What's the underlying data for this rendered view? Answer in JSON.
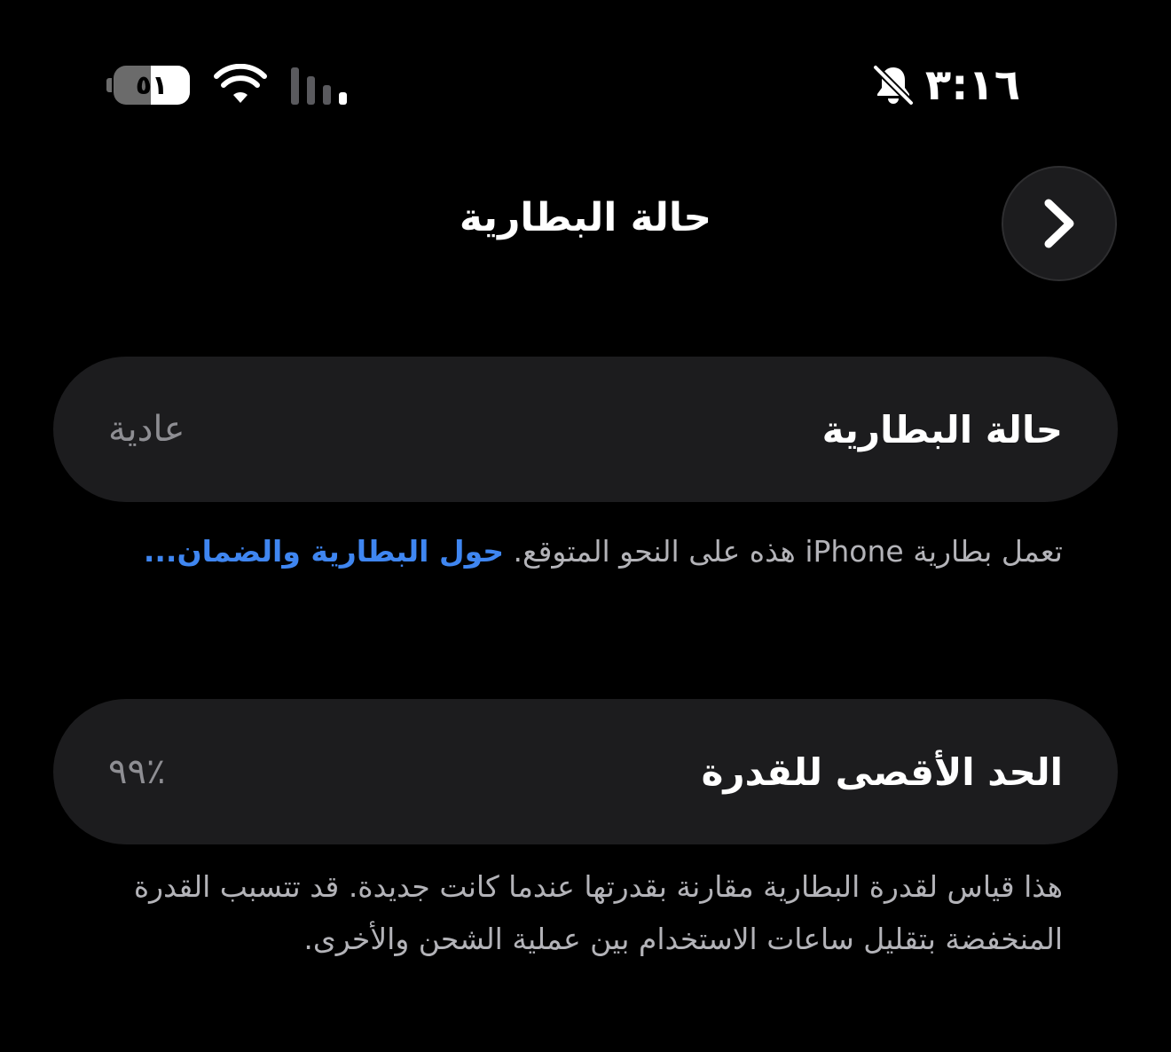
{
  "status_bar": {
    "time": "٣:١٦",
    "silent_icon": "bell-slash-icon",
    "battery_level": "٥١",
    "battery_fraction": 0.51,
    "wifi_icon": "wifi-icon",
    "signal_icon": "cellular-signal-icon"
  },
  "nav": {
    "title": "حالة البطارية",
    "back_icon": "chevron-right-icon"
  },
  "health_row": {
    "label": "حالة البطارية",
    "value": "عادية"
  },
  "health_note": {
    "text": "تعمل بطارية iPhone هذه على النحو المتوقع. ",
    "link": "حول البطارية والضمان..."
  },
  "capacity_row": {
    "label": "الحد الأقصى للقدرة",
    "value": "٪٩٩"
  },
  "capacity_note": {
    "text": "هذا قياس لقدرة البطارية مقارنة بقدرتها عندما كانت جديدة. قد تتسبب القدرة المنخفضة بتقليل ساعات الاستخدام بين عملية الشحن والأخرى."
  },
  "colors": {
    "background": "#000000",
    "card": "#1c1c1e",
    "link": "#3f86f1",
    "secondary_text": "#8e8e93"
  }
}
